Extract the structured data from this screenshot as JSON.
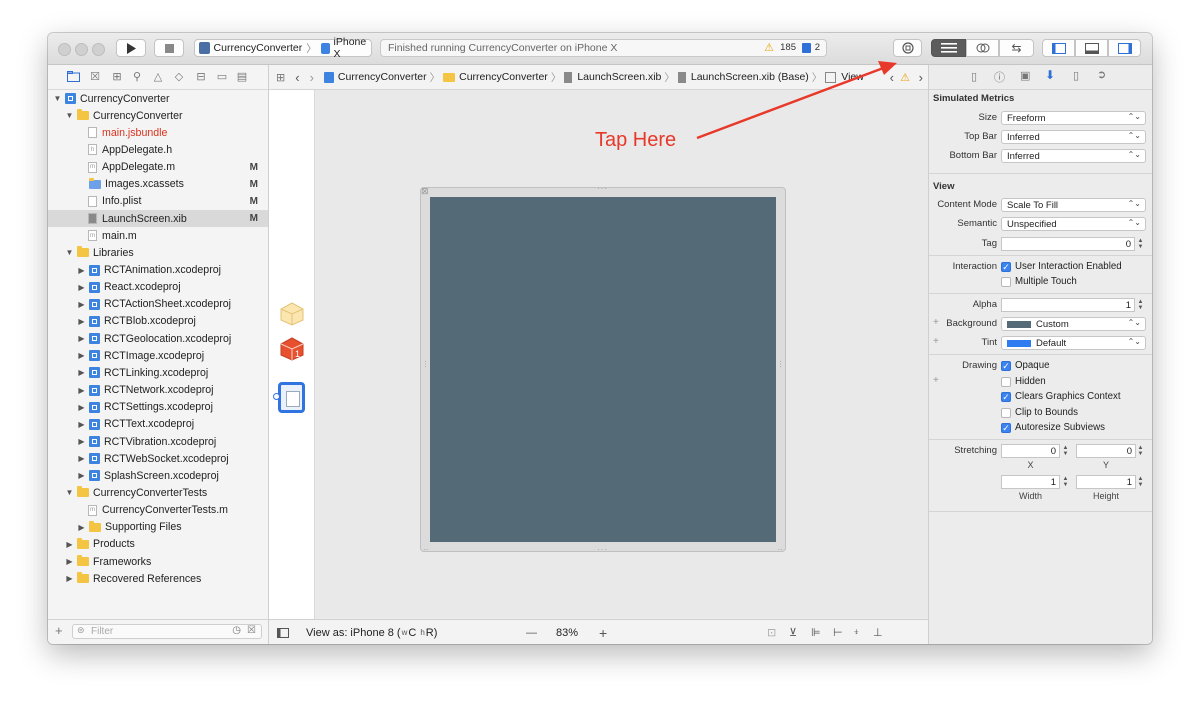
{
  "toolbar": {
    "scheme_name": "CurrencyConverter",
    "device_name": "iPhone X",
    "activity_text": "Finished running CurrencyConverter on iPhone X",
    "warning_count": "185",
    "error_count": "2"
  },
  "navigator": {
    "tree": [
      {
        "label": "CurrencyConverter",
        "type": "project",
        "level": 0,
        "expanded": true
      },
      {
        "label": "CurrencyConverter",
        "type": "folder",
        "level": 1,
        "expanded": true
      },
      {
        "label": "main.jsbundle",
        "type": "missing-file",
        "level": 2
      },
      {
        "label": "AppDelegate.h",
        "type": "file",
        "level": 2,
        "icon": "h"
      },
      {
        "label": "AppDelegate.m",
        "type": "file",
        "level": 2,
        "icon": "m",
        "badge": "M"
      },
      {
        "label": "Images.xcassets",
        "type": "asset",
        "level": 2,
        "badge": "M"
      },
      {
        "label": "Info.plist",
        "type": "file",
        "level": 2,
        "badge": "M"
      },
      {
        "label": "LaunchScreen.xib",
        "type": "xib",
        "level": 2,
        "badge": "M",
        "selected": true
      },
      {
        "label": "main.m",
        "type": "file",
        "level": 2,
        "icon": "m"
      },
      {
        "label": "Libraries",
        "type": "folder",
        "level": 1,
        "expanded": true
      },
      {
        "label": "RCTAnimation.xcodeproj",
        "type": "project",
        "level": 2,
        "collapsed": true
      },
      {
        "label": "React.xcodeproj",
        "type": "project",
        "level": 2,
        "collapsed": true
      },
      {
        "label": "RCTActionSheet.xcodeproj",
        "type": "project",
        "level": 2,
        "collapsed": true
      },
      {
        "label": "RCTBlob.xcodeproj",
        "type": "project",
        "level": 2,
        "collapsed": true
      },
      {
        "label": "RCTGeolocation.xcodeproj",
        "type": "project",
        "level": 2,
        "collapsed": true
      },
      {
        "label": "RCTImage.xcodeproj",
        "type": "project",
        "level": 2,
        "collapsed": true
      },
      {
        "label": "RCTLinking.xcodeproj",
        "type": "project",
        "level": 2,
        "collapsed": true
      },
      {
        "label": "RCTNetwork.xcodeproj",
        "type": "project",
        "level": 2,
        "collapsed": true
      },
      {
        "label": "RCTSettings.xcodeproj",
        "type": "project",
        "level": 2,
        "collapsed": true
      },
      {
        "label": "RCTText.xcodeproj",
        "type": "project",
        "level": 2,
        "collapsed": true
      },
      {
        "label": "RCTVibration.xcodeproj",
        "type": "project",
        "level": 2,
        "collapsed": true
      },
      {
        "label": "RCTWebSocket.xcodeproj",
        "type": "project",
        "level": 2,
        "collapsed": true
      },
      {
        "label": "SplashScreen.xcodeproj",
        "type": "project",
        "level": 2,
        "collapsed": true
      },
      {
        "label": "CurrencyConverterTests",
        "type": "folder",
        "level": 1,
        "expanded": true
      },
      {
        "label": "CurrencyConverterTests.m",
        "type": "file",
        "level": 2,
        "icon": "m"
      },
      {
        "label": "Supporting Files",
        "type": "folder",
        "level": 2,
        "collapsed": true
      },
      {
        "label": "Products",
        "type": "folder",
        "level": 1,
        "collapsed": true
      },
      {
        "label": "Frameworks",
        "type": "folder",
        "level": 1,
        "collapsed": true
      },
      {
        "label": "Recovered References",
        "type": "folder",
        "level": 1,
        "collapsed": true
      }
    ],
    "filter_placeholder": "Filter"
  },
  "jumpbar": {
    "crumbs": [
      "CurrencyConverter",
      "CurrencyConverter",
      "LaunchScreen.xib",
      "LaunchScreen.xib (Base)",
      "View"
    ]
  },
  "canvas": {
    "annotation_text": "Tap Here",
    "annotation_color": "#e8382a",
    "view_bg_color": "#546a76"
  },
  "bottom_bar": {
    "view_as_text": "View as: iPhone 8 (",
    "size_class_w": "w",
    "size_class_w_val": "C",
    "size_class_h": "h",
    "size_class_h_val": "R)",
    "zoom_minus": "—",
    "zoom_level": "83%",
    "zoom_plus": "+"
  },
  "inspector": {
    "simulated_metrics": {
      "title": "Simulated Metrics",
      "size_label": "Size",
      "size_value": "Freeform",
      "topbar_label": "Top Bar",
      "topbar_value": "Inferred",
      "bottombar_label": "Bottom Bar",
      "bottombar_value": "Inferred"
    },
    "view": {
      "title": "View",
      "content_mode_label": "Content Mode",
      "content_mode_value": "Scale To Fill",
      "semantic_label": "Semantic",
      "semantic_value": "Unspecified",
      "tag_label": "Tag",
      "tag_value": "0",
      "interaction_label": "Interaction",
      "user_interaction_label": "User Interaction Enabled",
      "user_interaction_checked": true,
      "multiple_touch_label": "Multiple Touch",
      "multiple_touch_checked": false,
      "alpha_label": "Alpha",
      "alpha_value": "1",
      "background_label": "Background",
      "background_value": "Custom",
      "background_swatch": "#546a76",
      "tint_label": "Tint",
      "tint_value": "Default",
      "tint_swatch": "#2f7bf0",
      "drawing_label": "Drawing",
      "opaque_label": "Opaque",
      "opaque_checked": true,
      "hidden_label": "Hidden",
      "hidden_checked": false,
      "clears_label": "Clears Graphics Context",
      "clears_checked": true,
      "clip_label": "Clip to Bounds",
      "clip_checked": false,
      "autoresize_label": "Autoresize Subviews",
      "autoresize_checked": true,
      "stretching_label": "Stretching",
      "stretch_x_value": "0",
      "stretch_y_value": "0",
      "x_label": "X",
      "y_label": "Y",
      "stretch_w_value": "1",
      "stretch_h_value": "1",
      "width_label": "Width",
      "height_label": "Height"
    }
  }
}
